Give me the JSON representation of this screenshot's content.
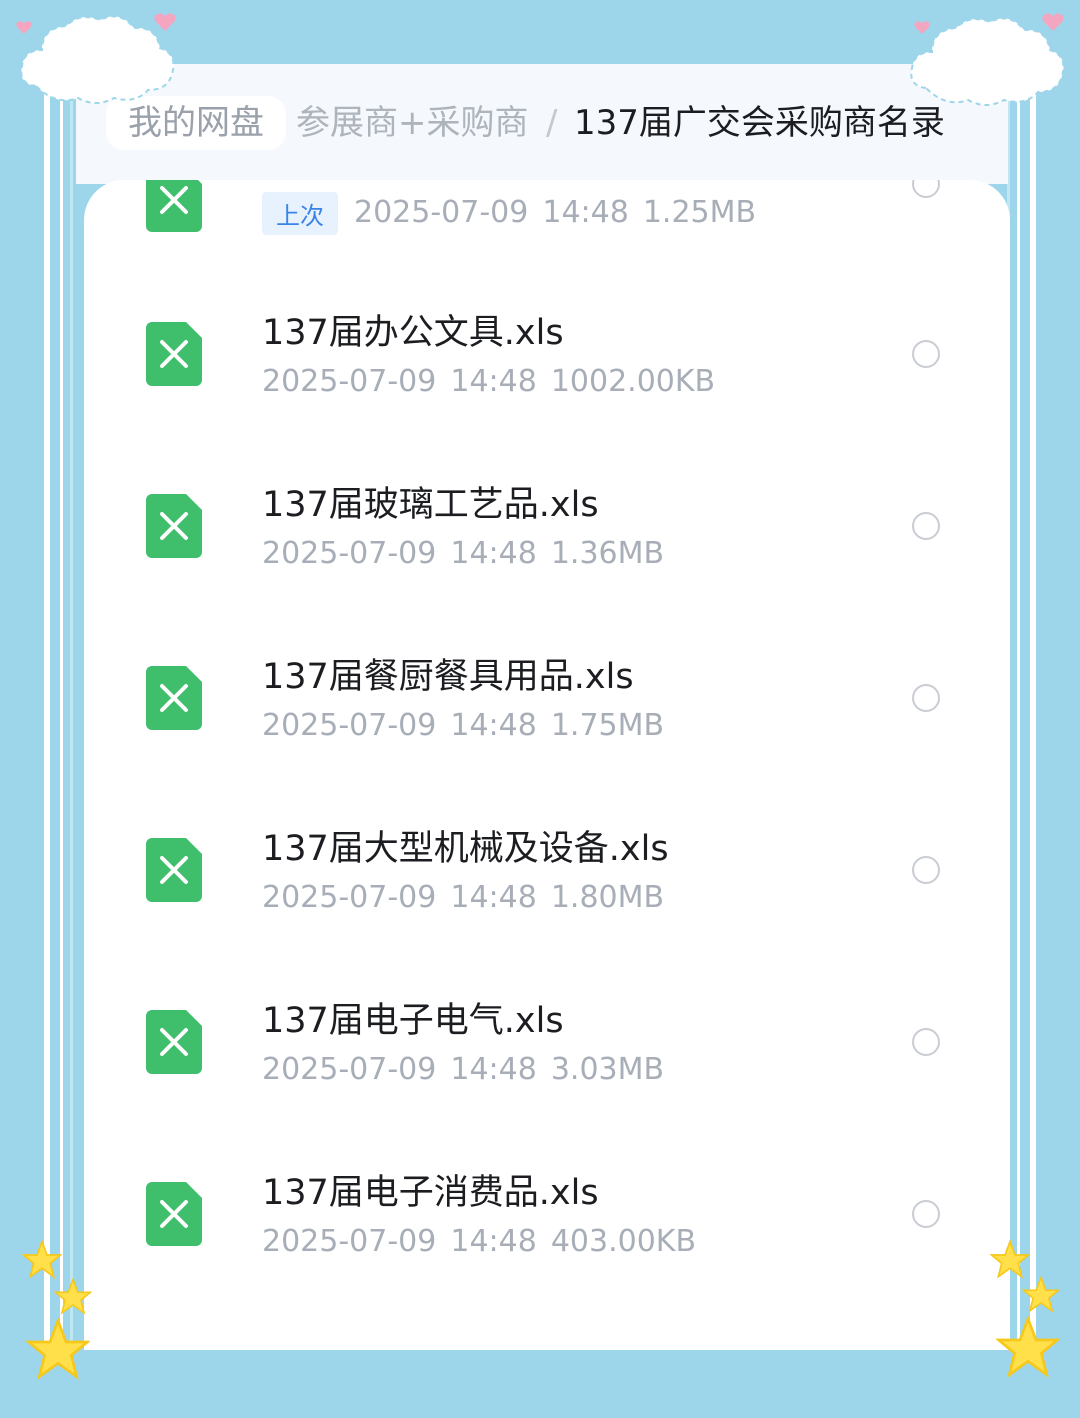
{
  "breadcrumb": {
    "home": "我的网盘",
    "middle": "参展商+采购商",
    "separator": "/",
    "current": "137届广交会采购商名录"
  },
  "last_tag": "上次",
  "files": [
    {
      "name": "",
      "date": "2025-07-09",
      "time": "14:48",
      "size": "1.25MB",
      "tag": "上次"
    },
    {
      "name": "137届办公文具.xls",
      "date": "2025-07-09",
      "time": "14:48",
      "size": "1002.00KB"
    },
    {
      "name": "137届玻璃工艺品.xls",
      "date": "2025-07-09",
      "time": "14:48",
      "size": "1.36MB"
    },
    {
      "name": "137届餐厨餐具用品.xls",
      "date": "2025-07-09",
      "time": "14:48",
      "size": "1.75MB"
    },
    {
      "name": "137届大型机械及设备.xls",
      "date": "2025-07-09",
      "time": "14:48",
      "size": "1.80MB"
    },
    {
      "name": "137届电子电气.xls",
      "date": "2025-07-09",
      "time": "14:48",
      "size": "3.03MB"
    },
    {
      "name": "137届电子消费品.xls",
      "date": "2025-07-09",
      "time": "14:48",
      "size": "403.00KB"
    }
  ],
  "colors": {
    "background": "#9dd6ea",
    "excel_green": "#3fbf6c",
    "tag_blue": "#3a84e8"
  },
  "icons": {
    "file_type": "excel-file-icon",
    "select": "radio-circle-icon",
    "decoration": [
      "cloud-icon",
      "heart-icon",
      "star-icon"
    ]
  }
}
